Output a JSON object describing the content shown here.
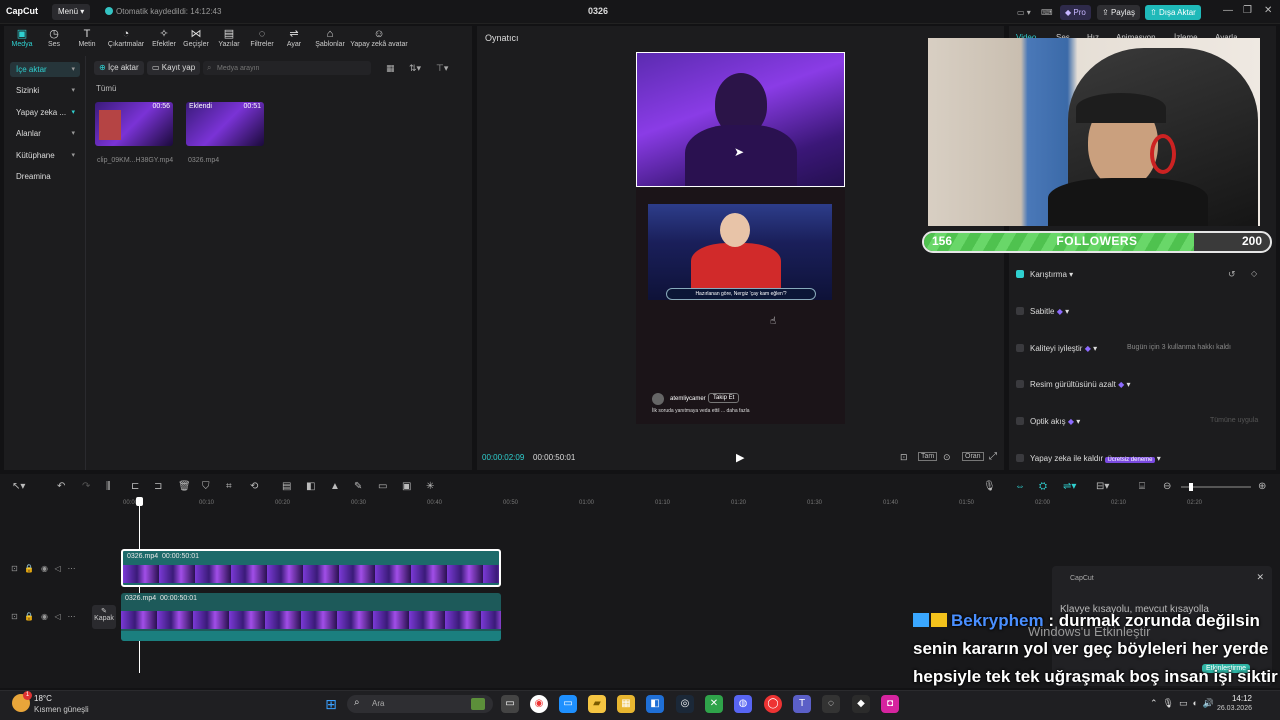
{
  "app": {
    "logo": "CapCut",
    "menu": "Menü",
    "autosave": "Otomatik kaydedildi: 14:12:43",
    "title": "0326",
    "pro": "Pro",
    "share": "Paylaş",
    "export": "Dışa Aktar"
  },
  "toolbar": [
    "Medya",
    "Ses",
    "Metin",
    "Çıkartmalar",
    "Efektler",
    "Geçişler",
    "Yazılar",
    "Filtreler",
    "Ayar",
    "Şablonlar",
    "Yapay zekâ avatar"
  ],
  "sidebar": [
    "İçe aktar",
    "Sizinki",
    "Yapay zeka ...",
    "Alanlar",
    "Kütüphane",
    "Dreamina"
  ],
  "media": {
    "import": "İçe aktar",
    "record": "Kayıt yap",
    "search_placeholder": "Medya arayın",
    "filter": "Tümü",
    "items": [
      {
        "name": "clip_09KM...H38GY.mp4",
        "duration": "00:56"
      },
      {
        "name": "0326.mp4",
        "tag": "Eklendi",
        "duration": "00:51"
      }
    ]
  },
  "player": {
    "title": "Oynatıcı",
    "current": "00:00:02:09",
    "total": "00:00:50:01",
    "ratio_btn": "Tam",
    "ratio2": "Oran",
    "overlay_text": "Hazırlanan göre, Nergiz 'çay kam eğlen'?",
    "account": "atemliycamer",
    "follow": "Takip Et",
    "caption": "İlk soruda yanıtmaya veda ettil ... daha fazla"
  },
  "inspector": {
    "tabs": [
      "Video",
      "Ses",
      "Hız",
      "Animasyon",
      "İzleme",
      "Ayarla"
    ],
    "items": [
      {
        "label": "Karıştırma",
        "on": true
      },
      {
        "label": "Sabitle",
        "on": false
      },
      {
        "label": "Kaliteyi iyileştir",
        "on": false,
        "hint": "Bugün için 3 kullanma hakkı kaldı"
      },
      {
        "label": "Resim gürültüsünü azalt",
        "on": false
      },
      {
        "label": "Optik akış",
        "on": false,
        "hint": "Tümüne uygula"
      },
      {
        "label": "Yapay zeka ile kaldır",
        "on": false,
        "badge": "Ücretsiz deneme"
      }
    ]
  },
  "timeline": {
    "ruler": [
      "00:00",
      "00:10",
      "00:20",
      "00:30",
      "00:40",
      "00:50",
      "01:00",
      "01:10",
      "01:20",
      "01:30",
      "01:40",
      "01:50",
      "02:00",
      "02:10",
      "02:20"
    ],
    "clips": [
      {
        "label": "0326.mp4",
        "duration": "00:00:50:01"
      },
      {
        "label": "0326.mp4",
        "duration": "00:00:50:01"
      }
    ],
    "cover": "Kapak"
  },
  "overlay": {
    "followers_current": "156",
    "followers_label": "FOLLOWERS",
    "followers_goal": "200",
    "followers_ratio": 0.78,
    "chat_user": "Bekryphem",
    "chat_message": ": durmak zorunda değilsin senin kararın yol ver geç böyleleri her yerde hepsiyle tek tek uğraşmak boş insan işi siktir etmek elitliktir",
    "toast_title": "CapCut",
    "toast_text": "Klavye kısayolu, mevcut kısayolla",
    "activate": "Windows'u Etkinleştir",
    "activate_btn": "Etkinleştirme"
  },
  "taskbar": {
    "temp": "18°C",
    "weather": "Kısmen güneşli",
    "search": "Ara",
    "time": "14:12",
    "date": "26.03.2026",
    "badge": "1"
  }
}
